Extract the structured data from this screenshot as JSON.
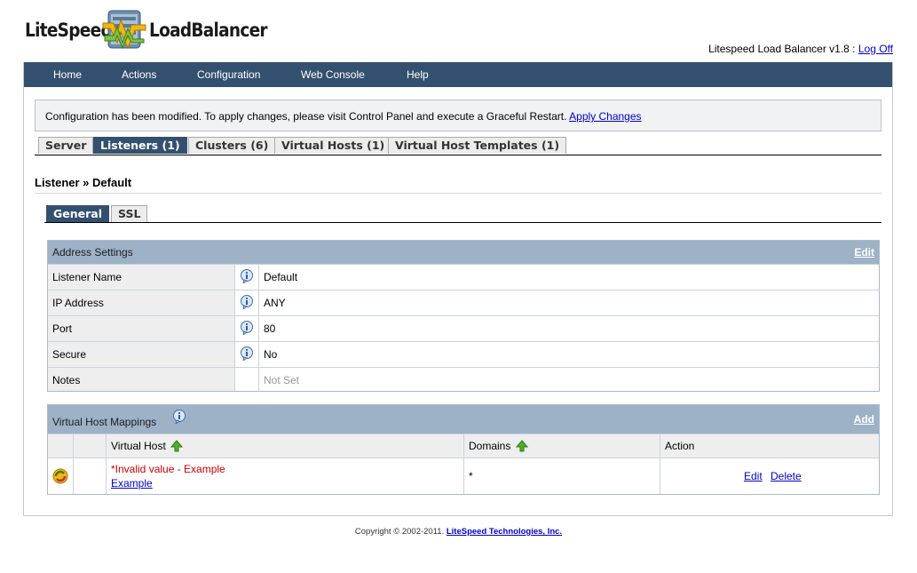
{
  "header": {
    "logo_left": "LiteSpeed",
    "logo_right": "LoadBalancer",
    "version_text": "Litespeed Load Balancer v1.8 : ",
    "logoff_label": "Log Off"
  },
  "nav": {
    "items": [
      "Home",
      "Actions",
      "Configuration",
      "Web Console",
      "Help"
    ]
  },
  "notice": {
    "text": "Configuration has been modified. To apply changes, please visit Control Panel and execute a Graceful Restart. ",
    "link": "Apply Changes"
  },
  "main_tabs": [
    "Server",
    "Listeners (1)",
    "Clusters (6)",
    "Virtual Hosts (1)",
    "Virtual Host Templates (1)"
  ],
  "breadcrumb": "Listener » Default",
  "sub_tabs": [
    "General",
    "SSL"
  ],
  "address": {
    "title": "Address Settings",
    "edit": "Edit",
    "rows": [
      {
        "label": "Listener Name",
        "value": "Default"
      },
      {
        "label": "IP Address",
        "value": "ANY"
      },
      {
        "label": "Port",
        "value": "80"
      },
      {
        "label": "Secure",
        "value": "No"
      },
      {
        "label": "Notes",
        "value": "Not Set"
      }
    ]
  },
  "mappings": {
    "title": "Virtual Host Mappings",
    "add": "Add",
    "col_vhost": "Virtual Host",
    "col_domains": "Domains",
    "col_action": "Action",
    "row": {
      "error": "*Invalid value - Example",
      "vhost": "Example",
      "domains": "*",
      "edit": "Edit",
      "delete": "Delete"
    }
  },
  "footer": {
    "text": "Copyright © 2002-2011. ",
    "link": "LiteSpeed Technologies, Inc."
  },
  "colors": {
    "nav_bg": "#34506f",
    "panel_head": "#9db1c7",
    "error": "#cc0000",
    "link": "#0000cc"
  }
}
